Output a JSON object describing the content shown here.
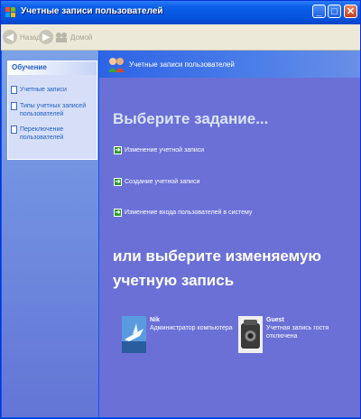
{
  "window": {
    "title": "Учетные записи пользователей"
  },
  "titlebar_buttons": {
    "minimize": "_",
    "maximize": "□",
    "close": "✕"
  },
  "toolbar": {
    "back_label": "Назад",
    "forward_label": "",
    "home_label": "Домой"
  },
  "sidebar": {
    "panel_title": "Обучение",
    "items": [
      {
        "label": "Учетные записи"
      },
      {
        "label": "Типы учетных записей пользователей"
      },
      {
        "label": "Переключение пользователей"
      }
    ]
  },
  "main": {
    "banner_title": "Учетные записи пользователей",
    "heading_task": "Выберите задание...",
    "tasks": [
      {
        "label": "Изменение учетной записи"
      },
      {
        "label": "Создание учетной записи"
      },
      {
        "label": "Изменение входа пользователей в систему"
      }
    ],
    "heading_account": "или выберите изменяемую учетную запись",
    "accounts": [
      {
        "name": "Nik",
        "desc": "Администратор компьютера"
      },
      {
        "name": "Guest",
        "desc": "Учетная запись гостя отключена"
      }
    ]
  },
  "colors": {
    "accent": "#0b56ea",
    "main_bg": "#6b70d7",
    "left_bg": "#7ba2e7",
    "task_icon": "#2f9a2a"
  },
  "icons": [
    "app-icon",
    "back-arrow-icon",
    "forward-arrow-icon",
    "home-icon",
    "users-icon",
    "doc-icon",
    "green-arrow-icon",
    "nik-avatar",
    "guest-avatar"
  ]
}
